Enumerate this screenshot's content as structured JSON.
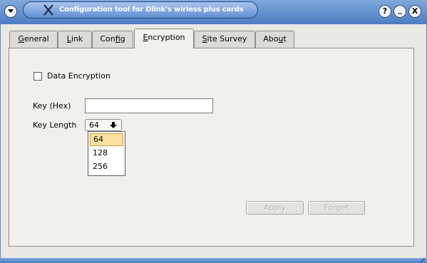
{
  "window": {
    "title": "Configuration tool for Dlink's wirless plus cards",
    "buttons": {
      "help": "?",
      "minimize": "_",
      "close": "X"
    }
  },
  "tabs": [
    {
      "label": "General",
      "mnemonic": "G",
      "rest": "eneral",
      "active": false
    },
    {
      "label": "Link",
      "mnemonic": "L",
      "rest": "ink",
      "active": false
    },
    {
      "label": "Config",
      "pre": "Con",
      "mnemonic": "f",
      "rest": "ig",
      "active": false
    },
    {
      "label": "Encryption",
      "mnemonic": "E",
      "rest": "ncryption",
      "active": true
    },
    {
      "label": "Site Survey",
      "mnemonic": "S",
      "rest": "ite Survey",
      "active": false
    },
    {
      "label": "About",
      "pre": "Abo",
      "mnemonic": "u",
      "rest": "t",
      "active": false
    }
  ],
  "encryption": {
    "data_encryption_label": "Data Encryption",
    "data_encryption_checked": false,
    "key_hex_label": "Key (Hex)",
    "key_hex_value": "",
    "key_length_label": "Key Length",
    "key_length_value": "64",
    "key_length_options": [
      "64",
      "128",
      "256"
    ],
    "highlighted_option": "64"
  },
  "actions": {
    "apply_label": "Apply",
    "forget_label": "Forget"
  }
}
